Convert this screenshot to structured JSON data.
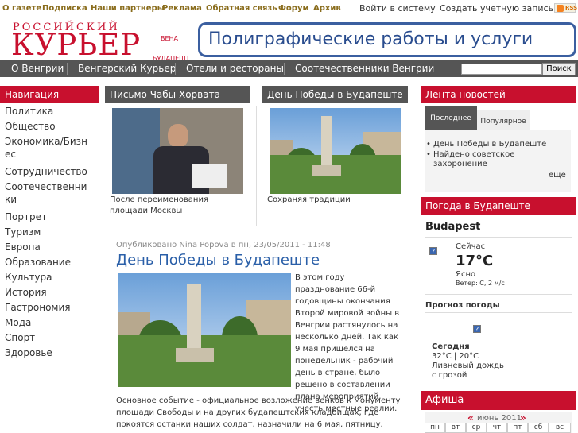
{
  "topbar": {
    "links": [
      "О газете",
      "Подписка",
      "Наши партнеры",
      "Реклама",
      "Обратная связь",
      "Форум",
      "Архив"
    ],
    "login": "Войти в систему",
    "register": "Создать учетную запись",
    "rss": "RSS"
  },
  "logo": {
    "small": "РОССИЙСКИЙ",
    "big": "КУРЬЕР",
    "sub1": "ВЕНА",
    "sub2": "БУДАПЕШТ"
  },
  "banner": "Полиграфические работы и услуги",
  "nav": {
    "items": [
      "О Венгрии",
      "Венгерский Курьер",
      "Отели и рестораны",
      "Соотечественники Венгрии"
    ],
    "search_button": "Поиск",
    "search_value": ""
  },
  "sidebar": {
    "title": "Навигация",
    "items": [
      "Политика",
      "Общество",
      "Экономика/Бизнес",
      "Сотрудничество",
      "Соотечественники",
      "Портрет",
      "Туризм",
      "Европа",
      "Образование",
      "Культура",
      "История",
      "Гастрономия",
      "Мода",
      "Спорт",
      "Здоровье"
    ]
  },
  "featured": [
    {
      "title": "Письмо Чабы Хорвата",
      "caption": "После переименования площади Москвы"
    },
    {
      "title": "День Победы в Будапеште",
      "caption": "Сохраняя традиции"
    }
  ],
  "article": {
    "meta": "Опубликовано Nina Popova в пн, 23/05/2011 - 11:48",
    "title": "День Победы в Будапеште",
    "text_side": [
      "В этом году",
      "празднование 66-й",
      "годовщины окончания",
      "Второй мировой войны в",
      "Венгрии растянулось на",
      "несколько дней. Так как",
      "9 мая пришелся на",
      "понедельник - рабочий",
      "день в стране, было",
      "решено в составлении",
      "плана мероприятий,",
      "учесть местные реалии."
    ],
    "text_full": [
      "Основное событие - официальное возложение венков к монументу",
      "площади Свободы и на других будапештских кладбищах, где",
      "покоятся останки наших солдат, назначили на 6 мая, пятницу."
    ]
  },
  "news": {
    "title": "Лента новостей",
    "tab_latest": "Последнее",
    "tab_popular": "Популярное",
    "items": [
      "День Победы в Будапеште",
      "Найдено советское захоронение"
    ],
    "more": "еще"
  },
  "weather": {
    "title": "Погода в Будапеште",
    "city": "Budapest",
    "now_label": "Сейчас",
    "temp": "17°C",
    "condition": "Ясно",
    "wind": "Ветер: С, 2 м/с",
    "forecast_title": "Прогноз погоды",
    "today_label": "Сегодня",
    "today_temp": "32°C | 20°C",
    "today_cond1": "Ливневый дождь",
    "today_cond2": "с грозой"
  },
  "afisha": {
    "title": "Афиша",
    "month": "июнь 2011",
    "prev": "«",
    "next": "»",
    "days": [
      "пн",
      "вт",
      "ср",
      "чт",
      "пт",
      "сб",
      "вс"
    ]
  },
  "colors": {
    "accent_red": "#c8102e",
    "nav_grey": "#555555",
    "link_gold": "#8a6d1d",
    "banner_blue": "#2a4d8f"
  }
}
